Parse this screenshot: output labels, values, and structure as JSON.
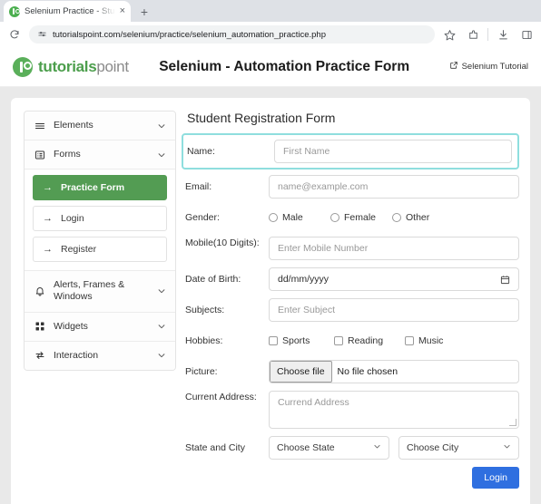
{
  "browser": {
    "tab": {
      "title": "Selenium Practice - Student R",
      "favicon_name": "tutorialspoint-favicon",
      "close_label": "×"
    },
    "new_tab_label": "+",
    "toolbar": {
      "reload_label": "↻",
      "site_info_name": "site-settings-icon",
      "url": "tutorialspoint.com/selenium/practice/selenium_automation_practice.php",
      "bookmark_name": "star-icon",
      "extensions_name": "extensions-icon",
      "download_name": "download-icon",
      "sidepanel_name": "side-panel-icon"
    }
  },
  "site_header": {
    "logo_primary": "tutorials",
    "logo_secondary": "point",
    "title": "Selenium - Automation Practice Form",
    "tutorial_link": "Selenium Tutorial"
  },
  "sidebar": {
    "groups": [
      {
        "label": "Elements",
        "icon": "hamburger-icon",
        "chevron": "⌄"
      },
      {
        "label": "Forms",
        "icon": "form-list-icon",
        "chevron": "⌄"
      },
      {
        "label": "Alerts, Frames & Windows",
        "icon": "bell-icon",
        "chevron": "⌄"
      },
      {
        "label": "Widgets",
        "icon": "widgets-grid-icon",
        "chevron": "⌄"
      },
      {
        "label": "Interaction",
        "icon": "interaction-arrows-icon",
        "chevron": "⌄"
      }
    ],
    "forms_children": [
      {
        "label": "Practice Form",
        "active": true,
        "arrow": "→"
      },
      {
        "label": "Login",
        "active": false,
        "arrow": "→"
      },
      {
        "label": "Register",
        "active": false,
        "arrow": "→"
      }
    ]
  },
  "form": {
    "title": "Student Registration Form",
    "name": {
      "label": "Name:",
      "placeholder": "First Name",
      "value": "",
      "highlighted": true
    },
    "email": {
      "label": "Email:",
      "placeholder": "name@example.com",
      "value": ""
    },
    "gender": {
      "label": "Gender:",
      "options": [
        "Male",
        "Female",
        "Other"
      ]
    },
    "mobile": {
      "label": "Mobile(10 Digits):",
      "placeholder": "Enter Mobile Number",
      "value": ""
    },
    "dob": {
      "label": "Date of Birth:",
      "value": "dd/mm/yyyy",
      "icon": "calendar-icon"
    },
    "subjects": {
      "label": "Subjects:",
      "placeholder": "Enter Subject",
      "value": ""
    },
    "hobbies": {
      "label": "Hobbies:",
      "options": [
        "Sports",
        "Reading",
        "Music"
      ]
    },
    "picture": {
      "label": "Picture:",
      "button": "Choose file",
      "status": "No file chosen"
    },
    "address": {
      "label": "Current Address:",
      "placeholder": "Currend Address",
      "value": ""
    },
    "state_city": {
      "label": "State and City",
      "state_value": "Choose State",
      "city_value": "Choose City",
      "chevron": "⌄"
    },
    "submit": "Login"
  },
  "colors": {
    "accent_green": "#539c53",
    "brand_green": "#4c9e4c",
    "highlight_cyan": "#8fdede",
    "submit_blue": "#2f6fe0"
  }
}
